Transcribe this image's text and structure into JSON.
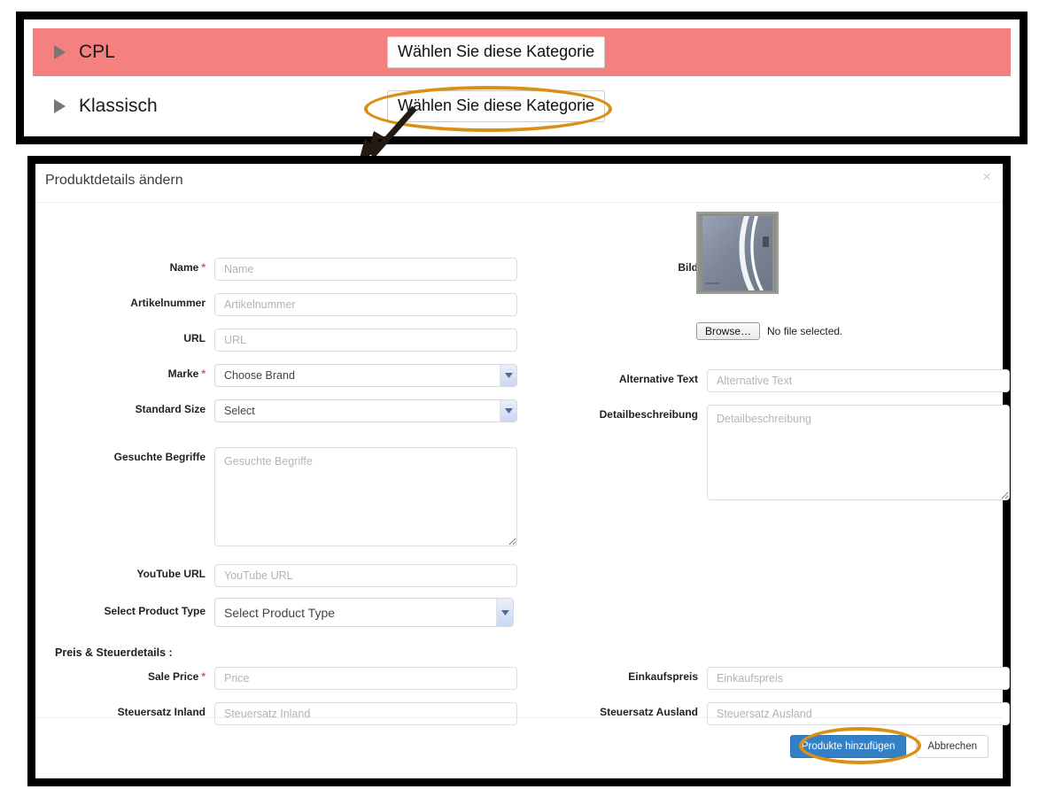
{
  "categories": {
    "rows": [
      {
        "label": "CPL",
        "button": "Wählen Sie diese Kategorie",
        "highlighted": true
      },
      {
        "label": "Klassisch",
        "button": "Wählen Sie diese Kategorie",
        "highlighted": false
      }
    ],
    "highlight_color": "#D99017",
    "row_accent_color": "#F4807F"
  },
  "modal": {
    "title": "Produktdetails ändern",
    "close_label": "×",
    "left_fields": [
      {
        "label": "Name",
        "required": true,
        "placeholder": "Name",
        "value": "",
        "type": "text"
      },
      {
        "label": "Artikelnummer",
        "required": false,
        "placeholder": "Artikelnummer",
        "value": "",
        "type": "text"
      },
      {
        "label": "URL",
        "required": false,
        "placeholder": "URL",
        "value": "",
        "type": "text"
      },
      {
        "label": "Marke",
        "required": true,
        "placeholder": "",
        "value": "Choose Brand",
        "type": "select"
      },
      {
        "label": "Standard Size",
        "required": false,
        "placeholder": "",
        "value": "Select",
        "type": "select"
      },
      {
        "label": "Gesuchte Begriffe",
        "required": false,
        "placeholder": "Gesuchte Begriffe",
        "value": "",
        "type": "textarea"
      },
      {
        "label": "YouTube URL",
        "required": false,
        "placeholder": "YouTube URL",
        "value": "",
        "type": "text"
      },
      {
        "label": "Select Product Type",
        "required": false,
        "placeholder": "",
        "value": "Select Product Type",
        "type": "select"
      }
    ],
    "right_fields": [
      {
        "label": "Bild",
        "required": false,
        "placeholder": "",
        "value": "",
        "type": "image"
      },
      {
        "label": "Alternative Text",
        "required": false,
        "placeholder": "Alternative Text",
        "value": "",
        "type": "text"
      },
      {
        "label": "Detailbeschreibung",
        "required": false,
        "placeholder": "Detailbeschreibung",
        "value": "",
        "type": "textarea"
      }
    ],
    "file_upload": {
      "browse_label": "Browse…",
      "status_text": "No file selected."
    },
    "price_section": {
      "title": "Preis & Steuerdetails :",
      "left_fields": [
        {
          "label": "Sale Price",
          "required": true,
          "placeholder": "Price",
          "value": ""
        },
        {
          "label": "Steuersatz Inland",
          "required": false,
          "placeholder": "Steuersatz Inland",
          "value": ""
        }
      ],
      "right_fields": [
        {
          "label": "Einkaufspreis",
          "required": false,
          "placeholder": "Einkaufspreis",
          "value": ""
        },
        {
          "label": "Steuersatz Ausland",
          "required": false,
          "placeholder": "Steuersatz Ausland",
          "value": ""
        }
      ]
    },
    "footer": {
      "primary_label": "Produkte hinzufügen",
      "secondary_label": "Abbrechen",
      "primary_color": "#3380C6",
      "highlight_color": "#D99017"
    }
  }
}
